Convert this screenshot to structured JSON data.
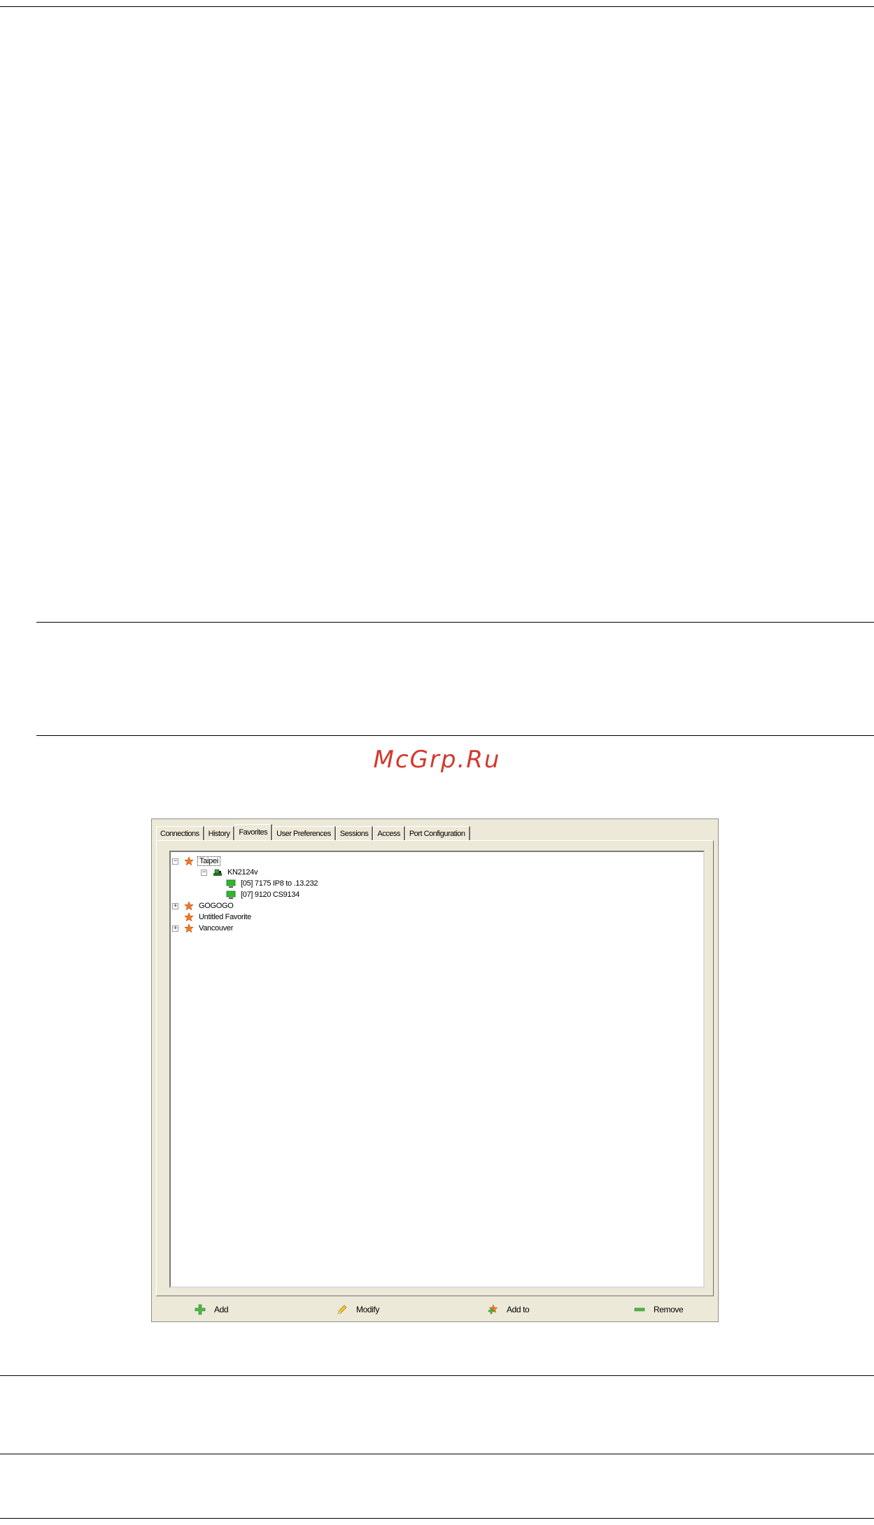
{
  "watermark": "McGrp.Ru",
  "tabs": [
    {
      "label": "Connections"
    },
    {
      "label": "History"
    },
    {
      "label": "Favorites"
    },
    {
      "label": "User Preferences"
    },
    {
      "label": "Sessions"
    },
    {
      "label": "Access"
    },
    {
      "label": "Port Configuration"
    }
  ],
  "active_tab": "Favorites",
  "tree": {
    "taipei": "Taipei",
    "kn2124v": "KN2124v",
    "port05": "[05] 7175 IP8 to .13.232",
    "port07": "[07] 9120 CS9134",
    "gogogo": "GOGOGO",
    "untitled": "Untitled Favorite",
    "vancouver": "Vancouver"
  },
  "buttons": {
    "add": "Add",
    "modify": "Modify",
    "add_to": "Add to",
    "remove": "Remove"
  },
  "colors": {
    "favorite_star": "#f07a22",
    "port_online": "#2eb82e",
    "watermark": "#d23a2e"
  }
}
